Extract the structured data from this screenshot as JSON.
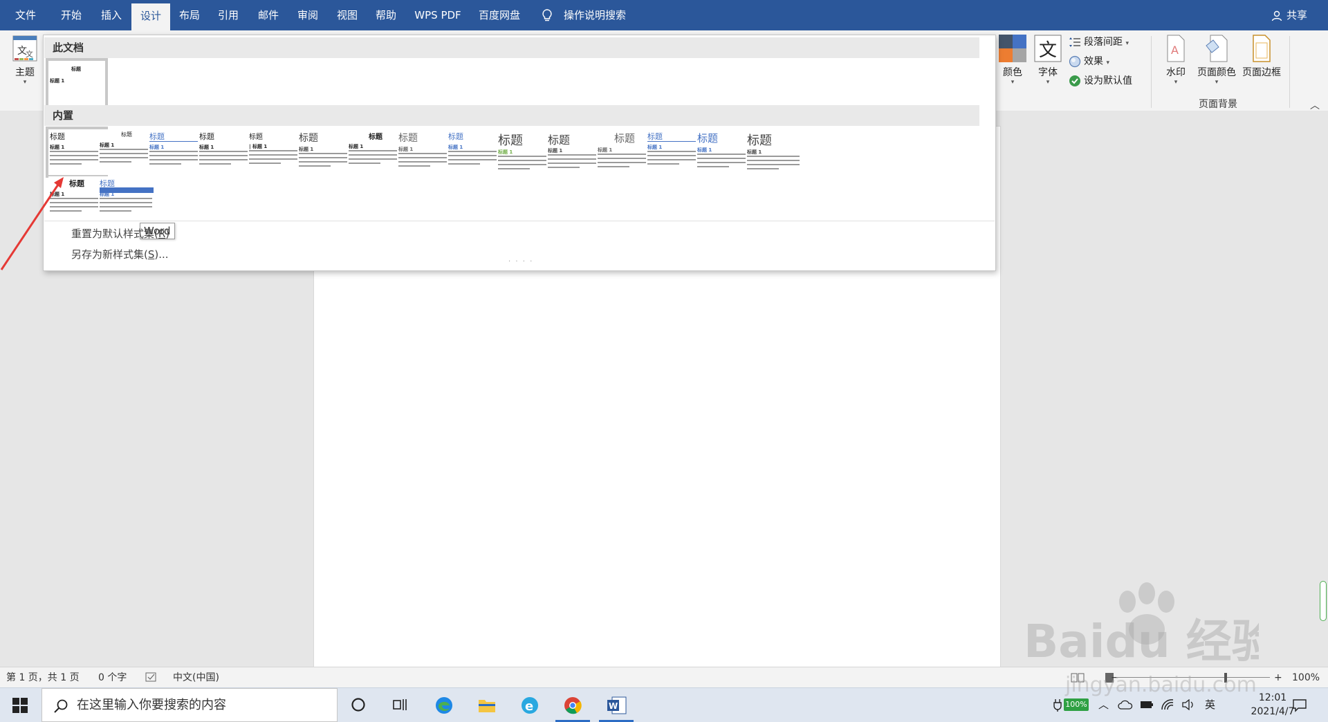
{
  "tabs": [
    "文件",
    "开始",
    "插入",
    "设计",
    "布局",
    "引用",
    "邮件",
    "审阅",
    "视图",
    "帮助",
    "WPS PDF",
    "百度网盘",
    "操作说明搜索"
  ],
  "active_tab": "设计",
  "share_label": "共享",
  "ribbon": {
    "theme_label": "主题",
    "colors_label": "颜色",
    "fonts_label": "字体",
    "paragraph_spacing_label": "段落间距",
    "effects_label": "效果",
    "set_default_label": "设为默认值",
    "watermark_label": "水印",
    "page_color_label": "页面颜色",
    "page_border_label": "页面边框",
    "page_background_group": "页面背景"
  },
  "gallery": {
    "this_document_header": "此文档",
    "builtin_header": "内置",
    "title_text": "标题",
    "heading_text": "标题 1",
    "tooltip": "Word",
    "reset_label": "重置为默认样式集(",
    "reset_key": "R",
    "save_label": "另存为新样式集(",
    "save_key": "S",
    "paren_close": ")",
    "ellipsis": "...",
    "accent_blue": "#4472c4",
    "accent_green": "#70ad47"
  },
  "status": {
    "page_info": "第 1 页，共 1 页",
    "word_count": "0 个字",
    "language": "中文(中国)",
    "zoom": "100%",
    "zoom_minus": "−",
    "zoom_plus": "+"
  },
  "taskbar": {
    "search_placeholder": "在这里输入你要搜索的内容",
    "battery": "100%",
    "ime": "英",
    "time": "12:01",
    "date": "2021/4/7"
  },
  "watermark": {
    "brand": "Baidu 经验",
    "url": "jingyan.baidu.com"
  }
}
